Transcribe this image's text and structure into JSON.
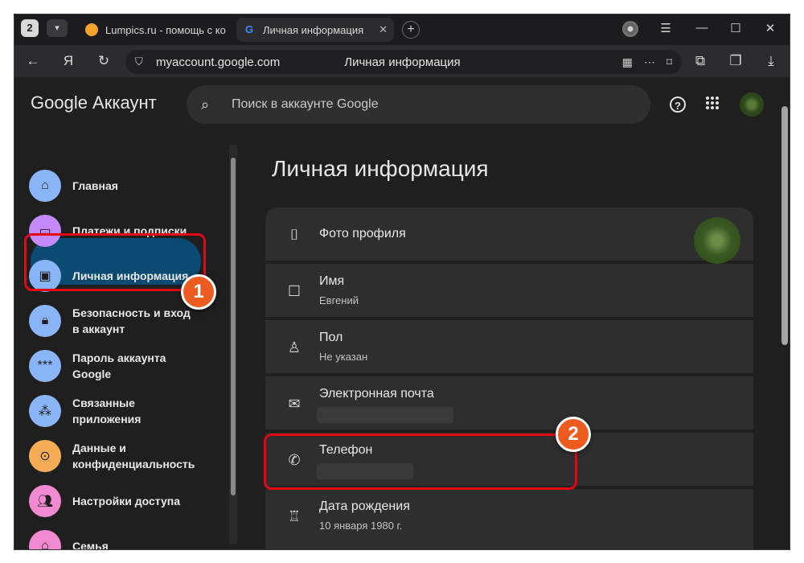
{
  "browser": {
    "tab_count": "2",
    "tabs": [
      {
        "title": "Lumpics.ru - помощь с ко"
      },
      {
        "title": "Личная информация"
      }
    ],
    "address": {
      "url": "myaccount.google.com",
      "page_title": "Личная информация"
    },
    "icons": [
      "back-icon",
      "yandex-icon",
      "reload-icon",
      "shield-icon",
      "translate-icon",
      "more-icon",
      "bookmark-icon",
      "extensions-icon",
      "collections-icon",
      "download-icon"
    ]
  },
  "header": {
    "logo": "Google Аккаунт",
    "search_placeholder": "Поиск в аккаунте Google"
  },
  "sidebar": {
    "items": [
      {
        "label": "Главная",
        "color": "#8ab4f8"
      },
      {
        "label": "Платежи и подписки",
        "color": "#c58af9"
      },
      {
        "label": "Личная информация",
        "color": "#8ab4f8"
      },
      {
        "label": "Безопасность и вход в аккаунт",
        "color": "#8ab4f8"
      },
      {
        "label": "Пароль аккаунта Google",
        "color": "#8ab4f8"
      },
      {
        "label": "Связанные приложения",
        "color": "#8ab4f8"
      },
      {
        "label": "Данные и конфиденциальность",
        "color": "#f6ad55"
      },
      {
        "label": "Настройки доступа",
        "color": "#f28ad2"
      },
      {
        "label": "Семья",
        "color": "#f28ad2"
      }
    ]
  },
  "main": {
    "title": "Личная информация",
    "rows": [
      {
        "label": "Фото профиля",
        "value": ""
      },
      {
        "label": "Имя",
        "value": "Евгений"
      },
      {
        "label": "Пол",
        "value": "Не указан"
      },
      {
        "label": "Электронная почта",
        "value": ""
      },
      {
        "label": "Телефон",
        "value": ""
      },
      {
        "label": "Дата рождения",
        "value": "10 января 1980 г."
      }
    ]
  },
  "annotations": {
    "badge1": "1",
    "badge2": "2",
    "highlight_color": "#e30613",
    "badge_color": "#ee5b1e"
  }
}
